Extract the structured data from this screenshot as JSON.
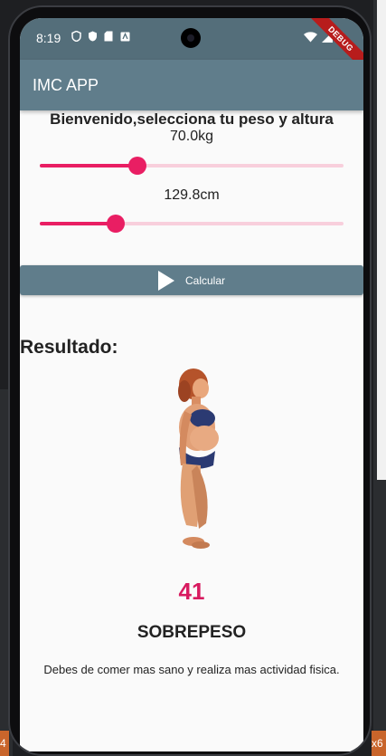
{
  "status_bar": {
    "time": "8:19",
    "debug_banner": "DEBUG"
  },
  "app_bar": {
    "title": "IMC APP"
  },
  "main": {
    "welcome": "Bienvenido,selecciona tu peso y altura",
    "weight": {
      "label": "70.0kg",
      "value_fraction": 0.32
    },
    "height": {
      "label": "129.8cm",
      "value_fraction": 0.25
    },
    "calculate_label": "Calcular",
    "result_heading": "Resultado:",
    "bmi_value": "41",
    "category": "SOBREPESO",
    "advice": "Debes de comer mas sano y realiza mas actividad fisica."
  },
  "colors": {
    "accent": "#e91e63",
    "bmi_value": "#d81b60",
    "app_bar": "#607d8b",
    "status_bar": "#546e7a"
  },
  "backdrop": {
    "left_tag": "4",
    "right_tag": "x6"
  }
}
